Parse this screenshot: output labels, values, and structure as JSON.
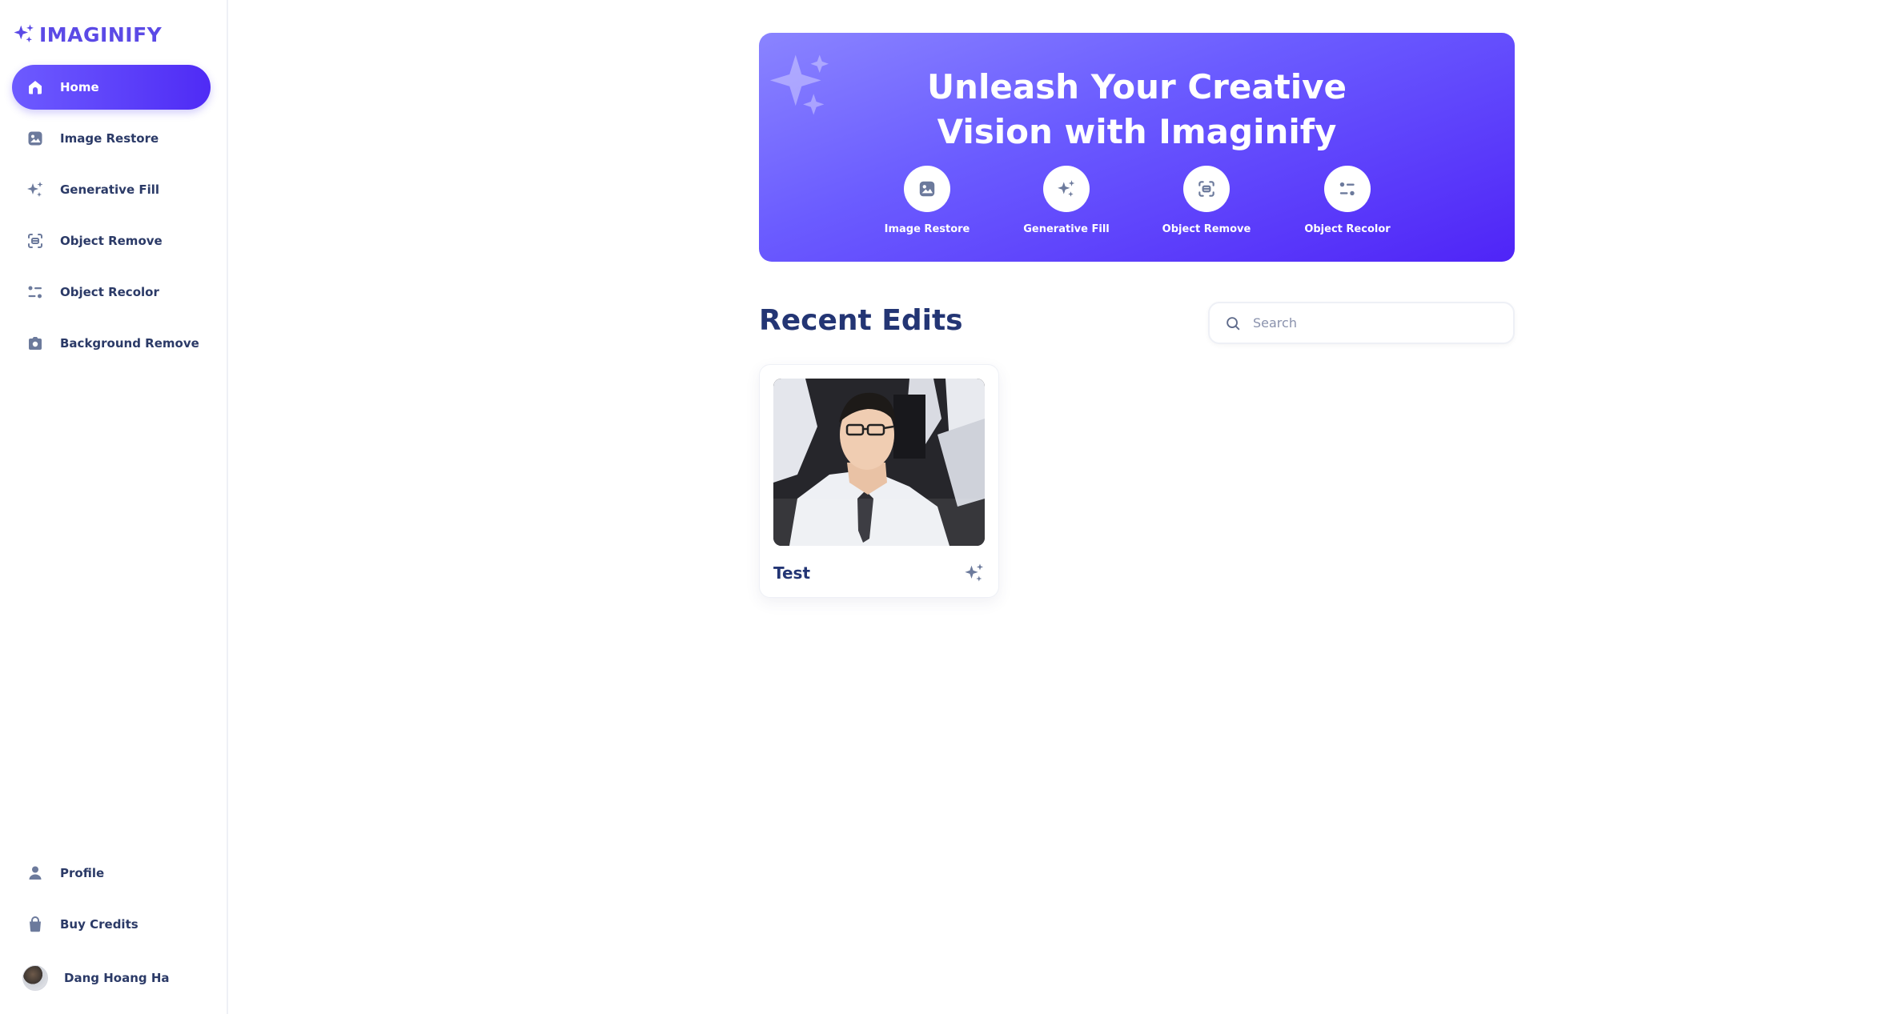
{
  "app": {
    "name": "IMAGINIFY"
  },
  "sidebar": {
    "items": [
      {
        "label": "Home",
        "icon": "home-icon",
        "active": true
      },
      {
        "label": "Image Restore",
        "icon": "image-icon"
      },
      {
        "label": "Generative Fill",
        "icon": "stars-icon"
      },
      {
        "label": "Object Remove",
        "icon": "scan-icon"
      },
      {
        "label": "Object Recolor",
        "icon": "filter-icon"
      },
      {
        "label": "Background Remove",
        "icon": "camera-icon"
      }
    ],
    "bottom_items": [
      {
        "label": "Profile",
        "icon": "profile-icon"
      },
      {
        "label": "Buy Credits",
        "icon": "bag-icon"
      }
    ],
    "user": {
      "name": "Dang Hoang Ha"
    }
  },
  "banner": {
    "title_line1": "Unleash Your Creative",
    "title_line2": "Vision with Imaginify",
    "actions": [
      {
        "label": "Image Restore",
        "icon": "image-icon"
      },
      {
        "label": "Generative Fill",
        "icon": "stars-icon"
      },
      {
        "label": "Object Remove",
        "icon": "scan-icon"
      },
      {
        "label": "Object Recolor",
        "icon": "filter-icon"
      }
    ]
  },
  "recent": {
    "title": "Recent Edits",
    "search_placeholder": "Search",
    "items": [
      {
        "title": "Test",
        "icon": "stars-icon"
      }
    ]
  },
  "colors": {
    "brand": "#5b4ae6",
    "active_gradient_start": "#6d5bff",
    "active_gradient_end": "#4f2bf5",
    "text_dark": "#233574",
    "icon_gray": "#6c7a9c"
  }
}
